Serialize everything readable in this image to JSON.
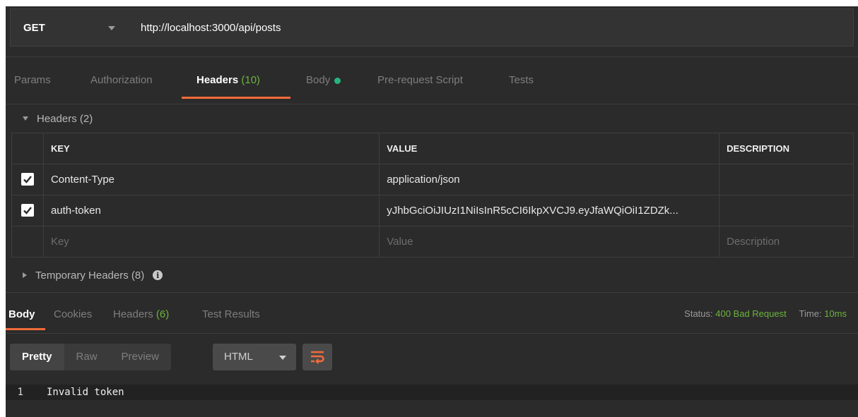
{
  "request": {
    "method": "GET",
    "url": "http://localhost:3000/api/posts"
  },
  "request_tabs": [
    {
      "label": "Params"
    },
    {
      "label": "Authorization"
    },
    {
      "label": "Headers",
      "count": "(10)"
    },
    {
      "label": "Body"
    },
    {
      "label": "Pre-request Script"
    },
    {
      "label": "Tests"
    }
  ],
  "headers_section": {
    "title": "Headers (2)",
    "columns": {
      "key": "KEY",
      "value": "VALUE",
      "description": "DESCRIPTION"
    },
    "rows": [
      {
        "key": "Content-Type",
        "value": "application/json",
        "description": ""
      },
      {
        "key": "auth-token",
        "value": "yJhbGciOiJIUzI1NiIsInR5cCI6IkpXVCJ9.eyJfaWQiOiI1ZDZk...",
        "description": ""
      }
    ],
    "placeholders": {
      "key": "Key",
      "value": "Value",
      "description": "Description"
    }
  },
  "temporary_headers": {
    "title": "Temporary Headers (8)"
  },
  "response_tabs": [
    {
      "label": "Body"
    },
    {
      "label": "Cookies"
    },
    {
      "label": "Headers",
      "count": "(6)"
    },
    {
      "label": "Test Results"
    }
  ],
  "status": {
    "status_label": "Status:",
    "status_value": "400 Bad Request",
    "time_label": "Time:",
    "time_value": "10ms"
  },
  "view_modes": [
    "Pretty",
    "Raw",
    "Preview"
  ],
  "format": "HTML",
  "response_body": [
    {
      "line": "1",
      "text": "Invalid token"
    }
  ],
  "colors": {
    "accent": "#f26b3a",
    "status_green": "#6cb33e",
    "body_dot": "#26b47f"
  }
}
